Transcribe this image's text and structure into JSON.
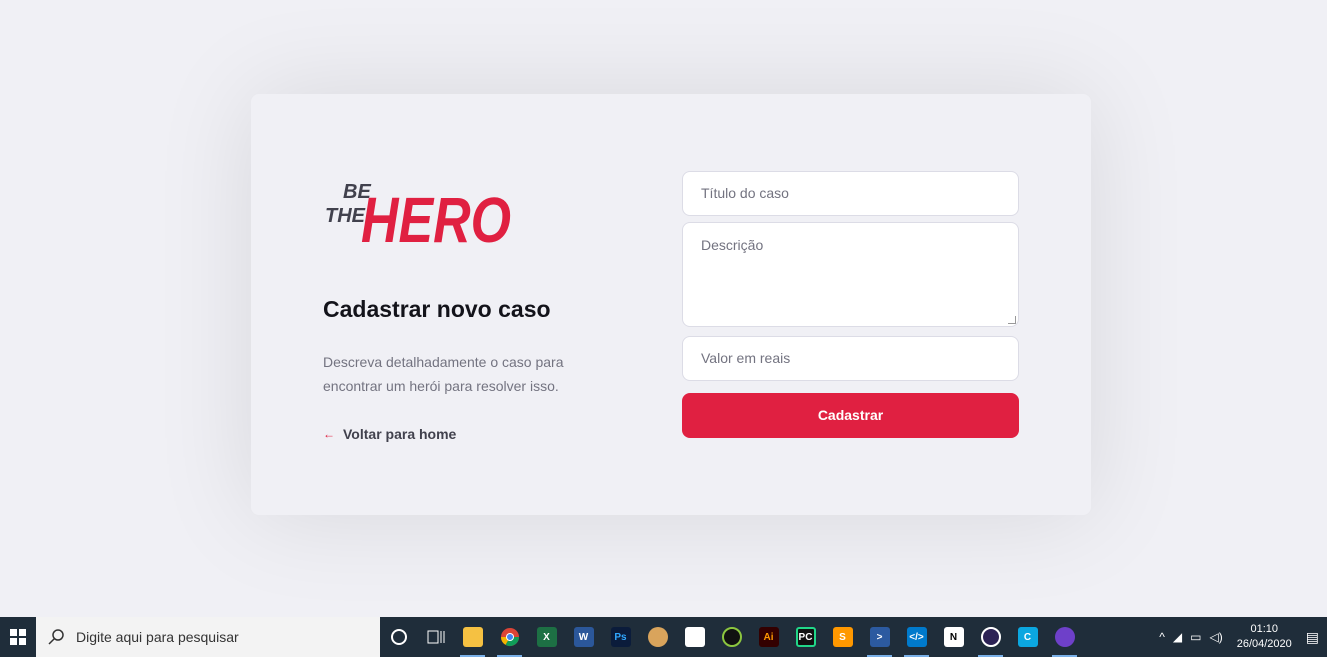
{
  "logo": {
    "line1": "BE",
    "line2": "THE",
    "word": "HERO"
  },
  "page": {
    "title": "Cadastrar novo caso",
    "description": "Descreva detalhadamente o caso para encontrar um herói para resolver isso.",
    "back_link": "Voltar para home"
  },
  "form": {
    "title_placeholder": "Título do caso",
    "description_placeholder": "Descrição",
    "value_placeholder": "Valor em reais",
    "submit_label": "Cadastrar"
  },
  "colors": {
    "accent": "#e02041",
    "background": "#f0f0f5",
    "dark": "#41414d"
  },
  "taskbar": {
    "search_placeholder": "Digite aqui para pesquisar",
    "time": "01:10",
    "date": "26/04/2020",
    "apps": [
      "cortana-icon",
      "task-view-icon",
      "file-explorer-icon",
      "chrome-icon",
      "excel-icon",
      "word-icon",
      "photoshop-icon",
      "paint-icon",
      "calculator-icon",
      "inkscape-icon",
      "illustrator-icon",
      "pycharm-icon",
      "sublime-icon",
      "powershell-icon",
      "vscode-icon",
      "notion-icon",
      "eclipse-icon",
      "cc-icon",
      "github-desktop-icon"
    ]
  }
}
